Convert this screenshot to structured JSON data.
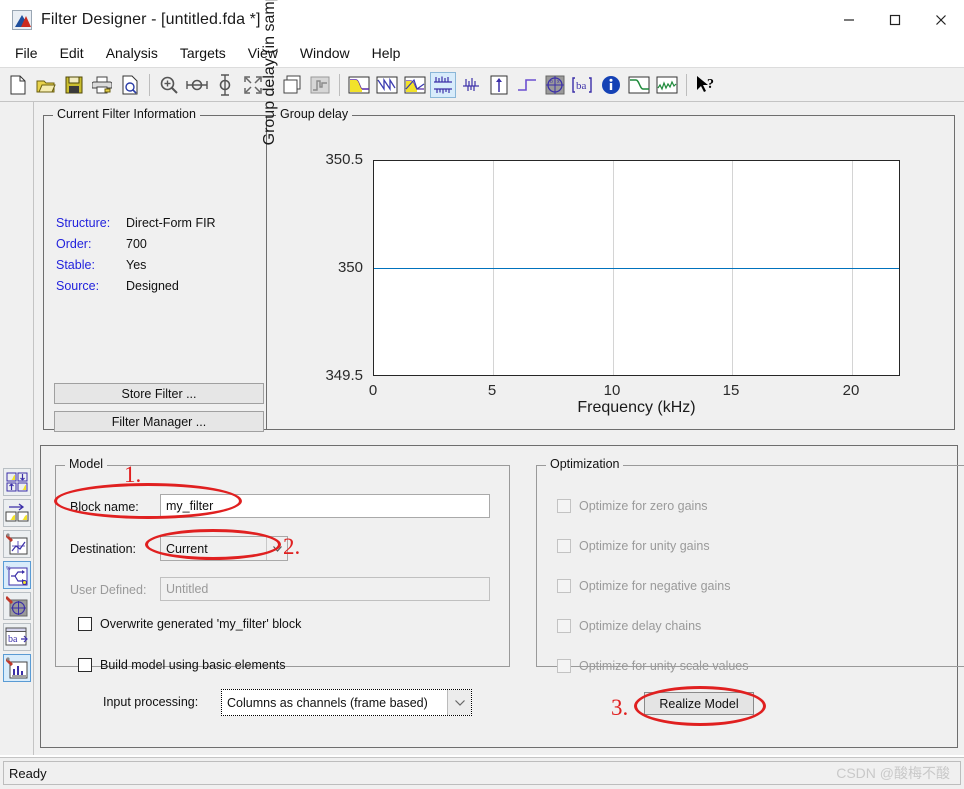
{
  "window": {
    "title": "Filter Designer -  [untitled.fda *]",
    "icon": "matlab-filter-icon",
    "controls": {
      "minimize": "minimize-icon",
      "maximize": "maximize-icon",
      "close": "close-icon"
    }
  },
  "menubar": {
    "items": [
      {
        "label": "File"
      },
      {
        "label": "Edit"
      },
      {
        "label": "Analysis"
      },
      {
        "label": "Targets"
      },
      {
        "label": "View"
      },
      {
        "label": "Window"
      },
      {
        "label": "Help"
      }
    ]
  },
  "toolbar": {
    "groups": [
      {
        "items": [
          {
            "name": "new-filter-icon",
            "label": "New"
          },
          {
            "name": "open-session-icon",
            "label": "Open"
          },
          {
            "name": "save-session-icon",
            "label": "Save"
          },
          {
            "name": "print-icon",
            "label": "Print"
          },
          {
            "name": "print-preview-icon",
            "label": "Print Preview"
          }
        ]
      },
      {
        "items": [
          {
            "name": "zoom-in-icon",
            "label": "Zoom In"
          },
          {
            "name": "zoom-x-icon",
            "label": "Zoom X"
          },
          {
            "name": "zoom-y-icon",
            "label": "Zoom Y"
          },
          {
            "name": "full-view-icon",
            "label": "Restore Default View"
          }
        ]
      },
      {
        "items": [
          {
            "name": "overlay-analysis-icon",
            "label": "Overlay Analysis"
          },
          {
            "name": "filter-spec-icon",
            "label": "Filter Specifications",
            "disabled": true
          }
        ]
      },
      {
        "items": [
          {
            "name": "magnitude-response-icon",
            "label": "Magnitude Response"
          },
          {
            "name": "phase-response-icon",
            "label": "Phase Response"
          },
          {
            "name": "magnitude-phase-icon",
            "label": "Magnitude and Phase Response"
          },
          {
            "name": "group-delay-icon",
            "label": "Group Delay Response",
            "selected": true
          },
          {
            "name": "phase-delay-icon",
            "label": "Phase Delay"
          },
          {
            "name": "impulse-response-icon",
            "label": "Impulse Response"
          },
          {
            "name": "step-response-icon",
            "label": "Step Response"
          },
          {
            "name": "pole-zero-icon",
            "label": "Pole/Zero Plot"
          },
          {
            "name": "filter-coefficients-icon",
            "label": "Filter Coefficients"
          },
          {
            "name": "filter-information-icon",
            "label": "Filter Information"
          },
          {
            "name": "magnitude-estimate-icon",
            "label": "Magnitude Response Estimate"
          },
          {
            "name": "round-off-noise-icon",
            "label": "Round-off Noise Power Spectrum"
          }
        ]
      },
      {
        "items": [
          {
            "name": "whats-this-icon",
            "label": "What's This?"
          }
        ]
      }
    ]
  },
  "sidebar": {
    "items": [
      {
        "name": "sidebar-item-design-filter",
        "icon": "design-filter-icon",
        "selected": false
      },
      {
        "name": "sidebar-item-import-filter",
        "icon": "import-filter-icon",
        "selected": false
      },
      {
        "name": "sidebar-item-quantize-filter",
        "icon": "quantize-filter-icon",
        "selected": false
      },
      {
        "name": "sidebar-item-realize-model",
        "icon": "realize-model-icon",
        "selected": true
      },
      {
        "name": "sidebar-item-pole-zero-editor",
        "icon": "pole-zero-editor-icon",
        "selected": false
      },
      {
        "name": "sidebar-item-transform-filter",
        "icon": "transform-filter-icon",
        "selected": false
      },
      {
        "name": "sidebar-item-set-quantization",
        "icon": "set-quantization-icon",
        "selected": false
      }
    ]
  },
  "filter_info": {
    "legend": "Current Filter Information",
    "rows": [
      {
        "key": "Structure:",
        "value": "Direct-Form FIR"
      },
      {
        "key": "Order:",
        "value": "700"
      },
      {
        "key": "Stable:",
        "value": "Yes"
      },
      {
        "key": "Source:",
        "value": "Designed"
      }
    ],
    "store_filter_label": "Store Filter ...",
    "filter_manager_label": "Filter Manager ..."
  },
  "chart_data": {
    "type": "line",
    "title": "Group delay",
    "xlabel": "Frequency (kHz)",
    "ylabel": "Group delay (in samples)",
    "xlim": [
      0,
      22.05
    ],
    "ylim": [
      349.5,
      350.5
    ],
    "xticks": [
      "0",
      "5",
      "10",
      "15",
      "20"
    ],
    "xtick_values": [
      0,
      5,
      10,
      15,
      20
    ],
    "yticks": [
      "349.5",
      "350",
      "350.5"
    ],
    "ytick_values": [
      349.5,
      350,
      350.5
    ],
    "grid": true,
    "legend": "none",
    "series": [
      {
        "name": "Group delay",
        "color": "#0072BD",
        "x": [
          0,
          5,
          10,
          15,
          20,
          22.05
        ],
        "values": [
          350,
          350,
          350,
          350,
          350,
          350
        ]
      }
    ]
  },
  "model": {
    "legend": "Model",
    "block_name_label": "Block name:",
    "block_name_value": "my_filter",
    "destination_label": "Destination:",
    "destination_value": "Current",
    "user_defined_label": "User Defined:",
    "user_defined_value": "Untitled",
    "overwrite_label": "Overwrite generated 'my_filter' block",
    "basic_elements_label": "Build model using basic elements",
    "input_processing_label": "Input processing:",
    "input_processing_value": "Columns as channels (frame based)"
  },
  "optimization": {
    "legend": "Optimization",
    "options": [
      {
        "label": "Optimize for zero gains"
      },
      {
        "label": "Optimize for unity gains"
      },
      {
        "label": "Optimize for negative gains"
      },
      {
        "label": "Optimize delay chains"
      },
      {
        "label": "Optimize for unity scale values"
      }
    ]
  },
  "realize_button": {
    "label": "Realize Model"
  },
  "annotations": [
    {
      "number": "1."
    },
    {
      "number": "2."
    },
    {
      "number": "3."
    }
  ],
  "statusbar": {
    "text": "Ready",
    "watermark": "CSDN @酸梅不酸"
  },
  "colors": {
    "accent_blue": "#0072BD",
    "info_key_blue": "#2222dd",
    "annotation_red": "#e02020",
    "window_bg": "#f0f0f0"
  }
}
